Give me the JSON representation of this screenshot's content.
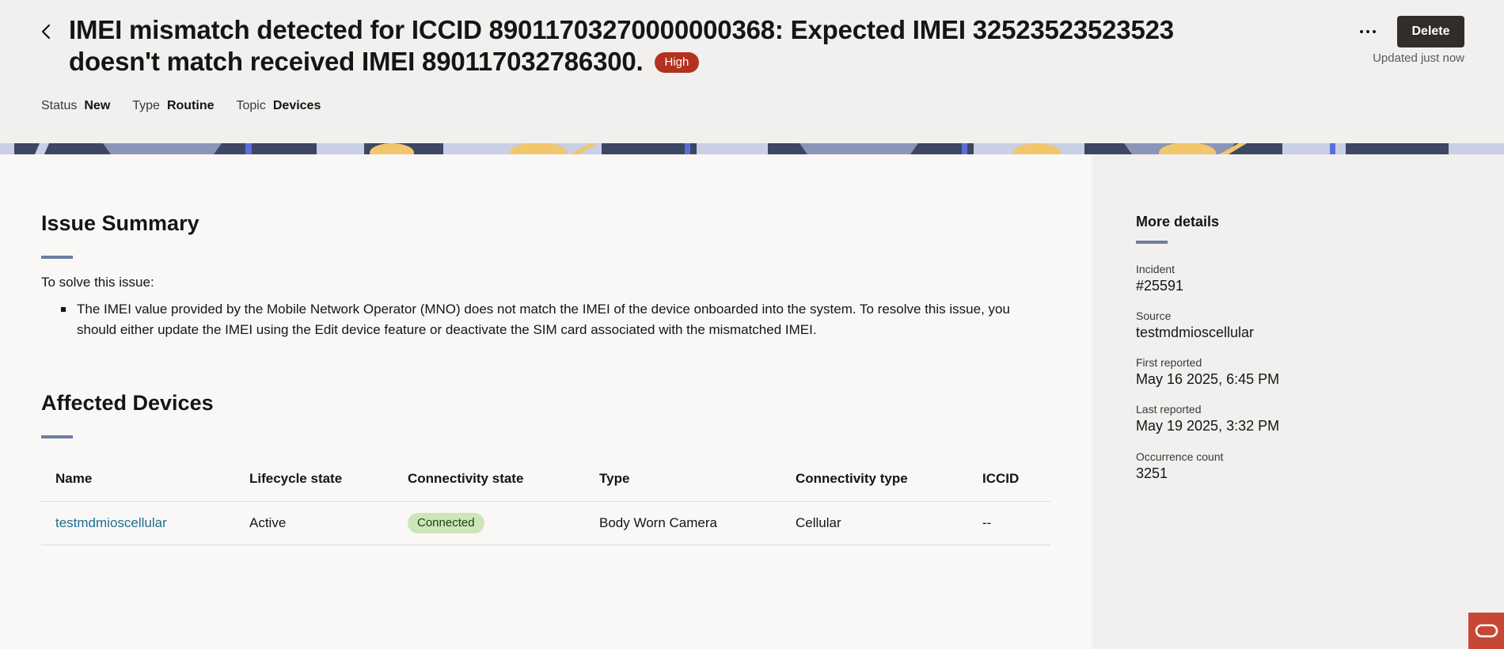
{
  "header": {
    "title": "IMEI mismatch detected for ICCID 89011703270000000368: Expected IMEI 32523523523523 doesn't match received IMEI 890117032786300.",
    "severity": "High",
    "delete_label": "Delete",
    "updated": "Updated just now",
    "meta": [
      {
        "label": "Status",
        "value": "New"
      },
      {
        "label": "Type",
        "value": "Routine"
      },
      {
        "label": "Topic",
        "value": "Devices"
      }
    ]
  },
  "summary": {
    "title": "Issue Summary",
    "intro": "To solve this issue:",
    "items": [
      "The IMEI value provided by the Mobile Network Operator (MNO) does not match the IMEI of the device onboarded into the system. To resolve this issue, you should either update the IMEI using the Edit device feature or deactivate the SIM card associated with the mismatched IMEI."
    ]
  },
  "devices": {
    "title": "Affected Devices",
    "columns": [
      "Name",
      "Lifecycle state",
      "Connectivity state",
      "Type",
      "Connectivity type",
      "ICCID"
    ],
    "rows": [
      {
        "name": "testmdmioscellular",
        "lifecycle": "Active",
        "connectivity": "Connected",
        "type": "Body Worn Camera",
        "connectivity_type": "Cellular",
        "iccid": "--"
      }
    ]
  },
  "details": {
    "title": "More details",
    "items": [
      {
        "label": "Incident",
        "value": "#25591"
      },
      {
        "label": "Source",
        "value": "testmdmioscellular"
      },
      {
        "label": "First reported",
        "value": "May 16 2025, 6:45 PM"
      },
      {
        "label": "Last reported",
        "value": "May 19 2025, 3:32 PM"
      },
      {
        "label": "Occurrence count",
        "value": "3251"
      }
    ]
  },
  "colors": {
    "severity_high": "#b3311f",
    "connected": "#cde6b8",
    "link": "#1d6f8f",
    "accent_rule": "#6e7ea1",
    "delete_button": "#312d2a",
    "oracle_red": "#c74634"
  }
}
